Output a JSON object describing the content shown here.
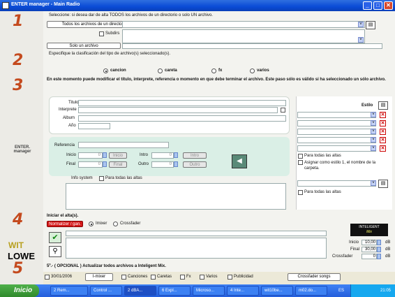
{
  "window": {
    "title": "ENTER manager  - Main Radio",
    "min": "_",
    "max": "□",
    "close": "✕"
  },
  "left": {
    "n1": "1",
    "n2": "2",
    "n3": "3",
    "n4": "4",
    "n5": "5",
    "brand1": "ENTER.",
    "brand2": "manager",
    "wit": "WIT",
    "lowe": "LOWE"
  },
  "s1": {
    "title": "Seleccione: si desea dar de alta TODOS los archivos de un directorio o solo UN archivo.",
    "btn_all": "Todos los archivos de un directorio",
    "subdirs": "Subdirs",
    "btn_one": "Solo un archivo"
  },
  "s2": {
    "title": "Especifique la clasificación del tipo de archivo(s) seleccionado(s).",
    "options": [
      "cancion",
      "careta",
      "fx",
      "varios"
    ]
  },
  "s3": {
    "title": "En este momento puede modificar el título, interprete, referencia o momento en que debe terminar el archivo. Este paso sólo es válido si ha seleccionado un sólo archivo.",
    "titulo": "Titulo",
    "interprete": "Interprete",
    "album": "Album",
    "anio": "Año",
    "estilo": "Estilo",
    "para_todas_1": "Para todas las altas",
    "asignar": "Asignar como estilo 1, el nombre de la carpeta.",
    "para_todas_2": "Para todas las altas",
    "referencia": "Referencia",
    "inicio": "Inicio",
    "final": "Final",
    "intro": "Intro",
    "outro": "Outro",
    "inicio_val": "0",
    "final_val": "0",
    "intro_val": "0",
    "outro_val": "0",
    "btn_inicio": "Inicio",
    "btn_final": "Final",
    "btn_intro": "Intro",
    "btn_outro": "Outro",
    "info_system": "Info system",
    "para_todas_info": "Para todas las altas"
  },
  "s4": {
    "title": "Iniciar el alta(s).",
    "normalizer": "Normalizer / gan.",
    "imixer": "Imixer",
    "crossfader": "Crossfader",
    "logo": "INTELIGENT",
    "logo2": "Mix",
    "inicio": "Inicio",
    "inicio_val": "10,00",
    "final": "Final",
    "final_val": "30,00",
    "crossfader_lbl": "Crossfader",
    "cross_val": "0",
    "db": "dB"
  },
  "s5": {
    "title": "5º.- ( OPCIONAL ) Actualizar todos archivos a Inteligent Mix.",
    "date": "30/01/2006",
    "imixer_btn": "I-mixer",
    "canciones": "Canciones",
    "caretas": "Caretas",
    "fx": "Fx",
    "varios": "Varios",
    "publicidad": "Publicidad",
    "crossfade_songs": "Crossfader songs"
  },
  "taskbar": {
    "start": "Inicio",
    "items": [
      "2 Rem...",
      "Control ...",
      "2 dBA...",
      "6 Expl...",
      "Microso...",
      "4 Inte...",
      "wit10be...",
      "m02.do..."
    ],
    "lang": "ES",
    "clock": "21:05"
  },
  "colors": {
    "accent": "#c44a1e",
    "title_bar": "#0a4bd6",
    "normalizer": "#d41a1a"
  }
}
